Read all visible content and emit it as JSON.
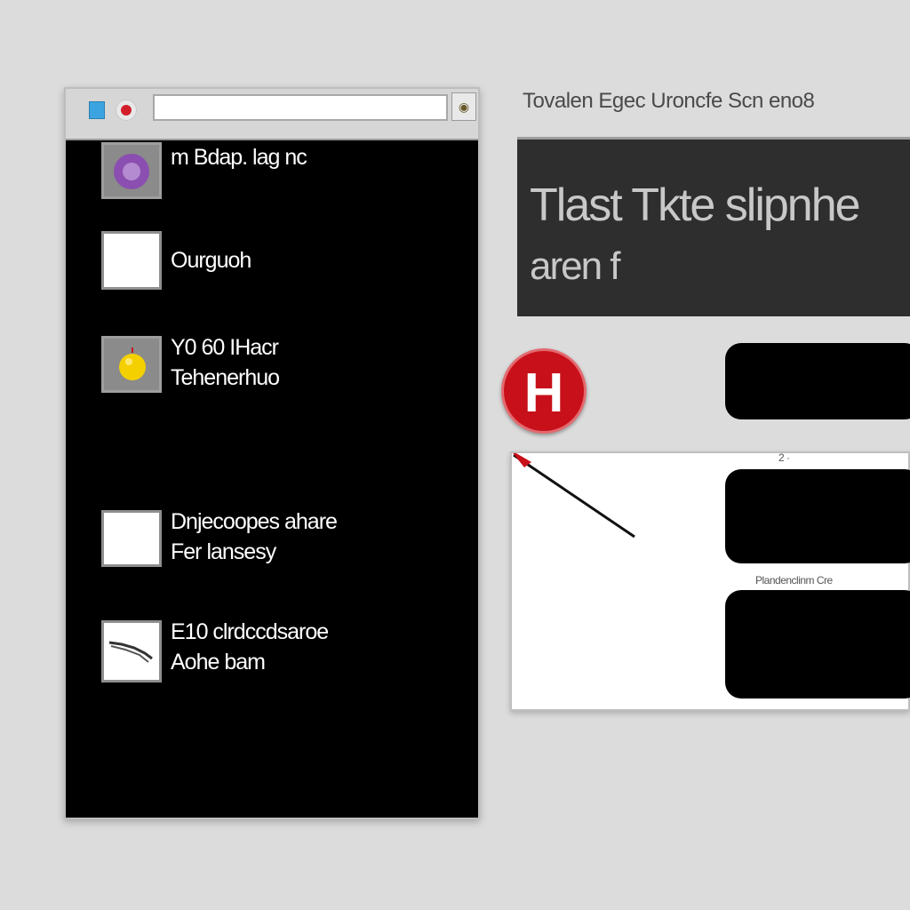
{
  "window": {
    "url_value": "",
    "go_icon": "search-icon"
  },
  "list": {
    "items": [
      {
        "text_lines": [
          "m Bdap. lag nc"
        ],
        "icon": "purple-logo-icon"
      },
      {
        "text_lines": [
          "Ourguoh"
        ],
        "icon": "blank-document-icon"
      },
      {
        "text_lines": [
          "Y0 60 IHacr",
          "Tehenerhuo"
        ],
        "icon": "yellow-ball-icon"
      },
      {
        "text_lines": [
          "Dnjecoopes ahare",
          "Fer lansesy"
        ],
        "icon": "blank-document-icon"
      },
      {
        "text_lines": [
          "E10 clrdccdsaroe",
          "Aohe bam"
        ],
        "icon": "sketch-image-icon"
      }
    ]
  },
  "right": {
    "title": "Tovalen Egec Uroncfe Scn eno8",
    "banner_line1": "Tlast Tkte slipnhe",
    "banner_line2": "aren f",
    "badge_letter": "H",
    "panel_label_1": "2 ·",
    "panel_label_2": "Plandenclinm   Cre"
  },
  "colors": {
    "accent_red": "#c8101a",
    "purple": "#8a4fb0",
    "yellow": "#f4d000"
  }
}
